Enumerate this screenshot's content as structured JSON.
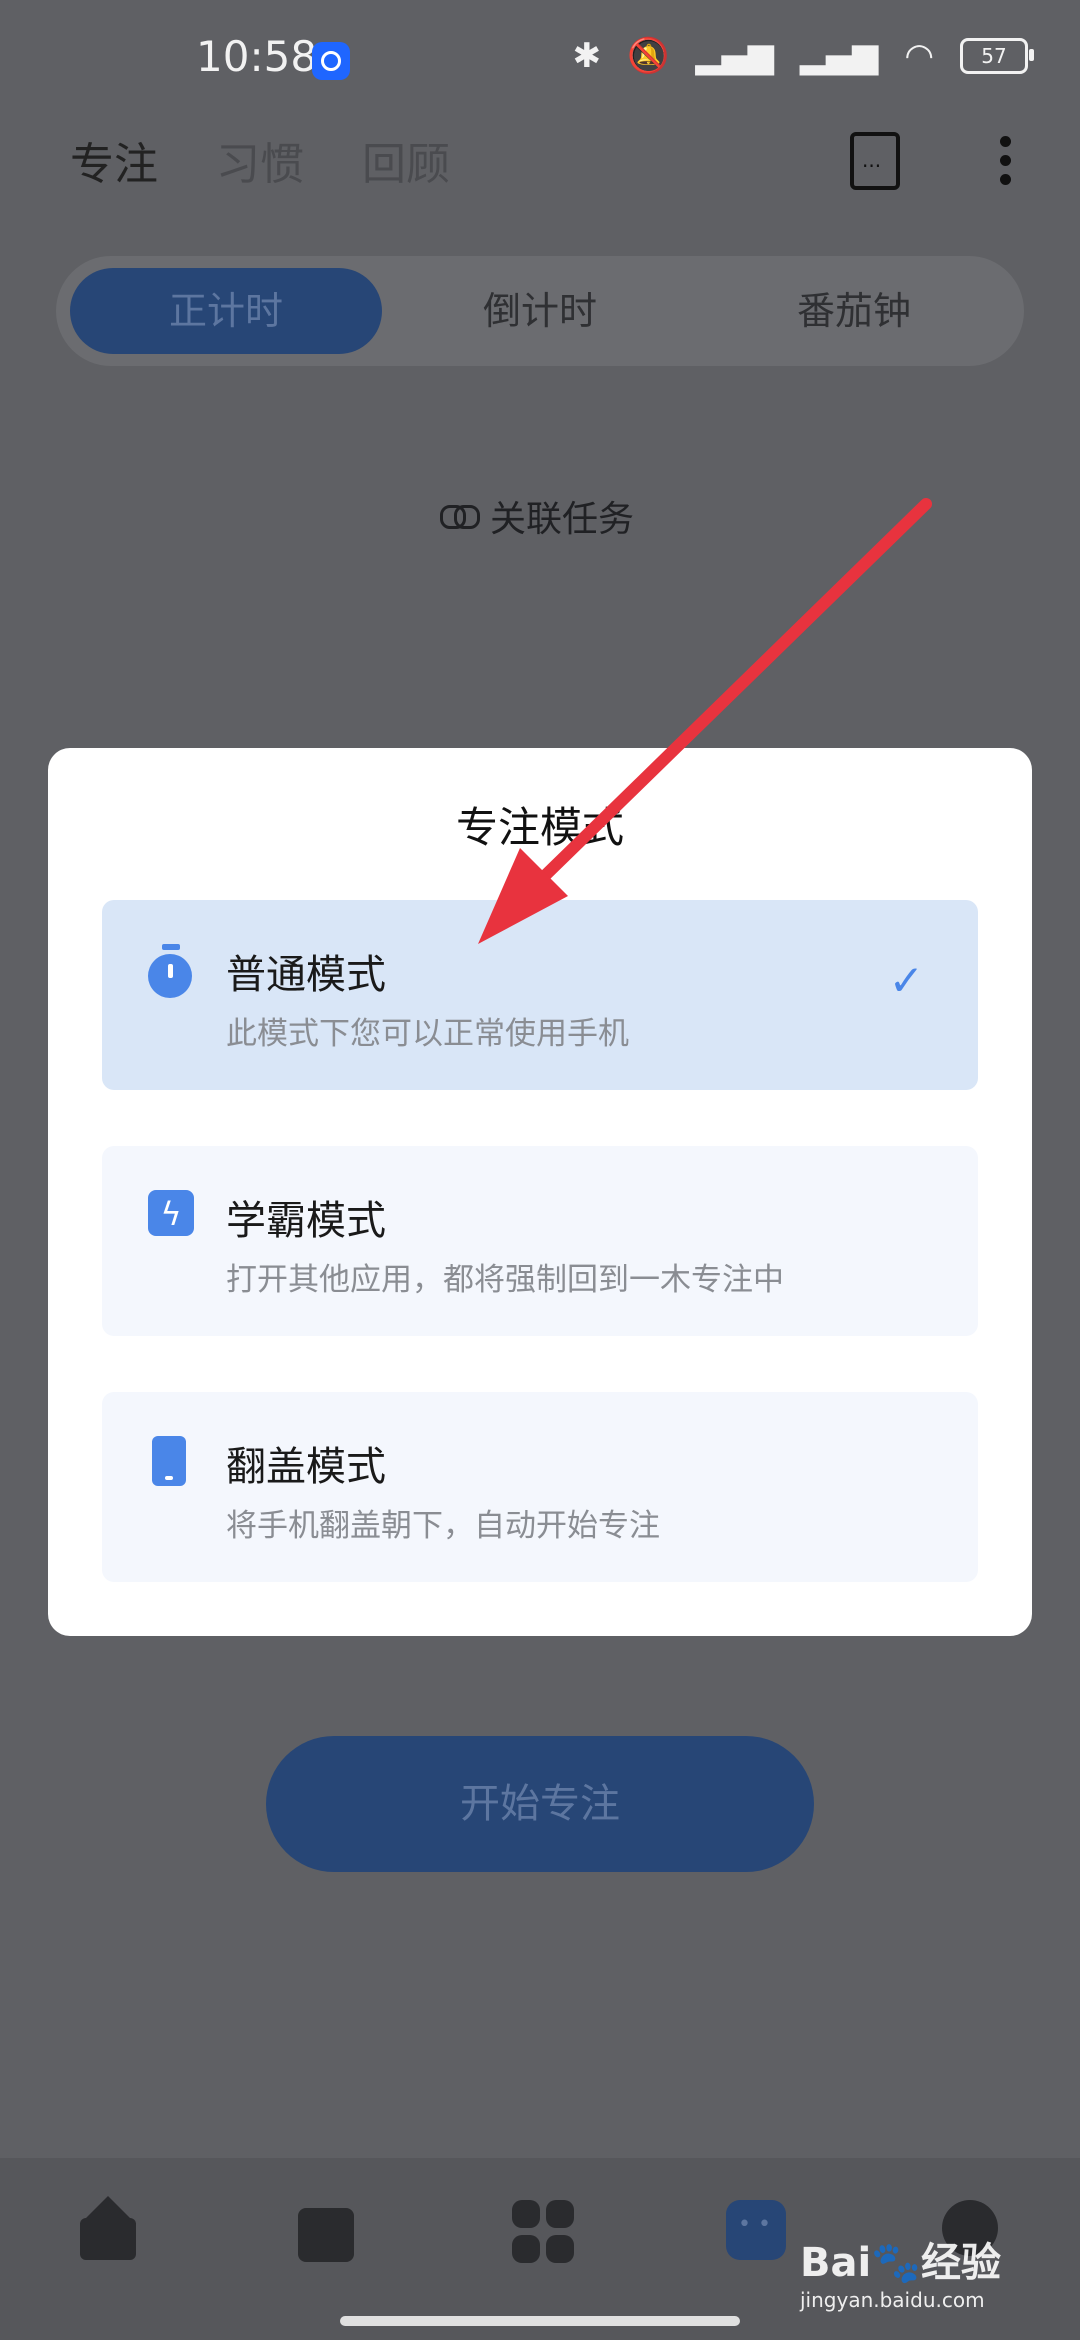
{
  "status_bar": {
    "time": "10:58",
    "battery": "57",
    "icons": [
      "bluetooth-icon",
      "mute-icon",
      "signal-hd-icon",
      "signal-hd-icon",
      "wifi-icon"
    ]
  },
  "header": {
    "tabs": [
      {
        "label": "专注",
        "active": true
      },
      {
        "label": "习惯",
        "active": false
      },
      {
        "label": "回顾",
        "active": false
      }
    ],
    "doc_icon_glyph": "..."
  },
  "segment": {
    "items": [
      {
        "label": "正计时",
        "active": true
      },
      {
        "label": "倒计时",
        "active": false
      },
      {
        "label": "番茄钟",
        "active": false
      }
    ]
  },
  "link_task": {
    "label": "关联任务"
  },
  "start_button": {
    "label": "开始专注"
  },
  "dialog": {
    "title": "专注模式",
    "options": [
      {
        "title": "普通模式",
        "desc": "此模式下您可以正常使用手机",
        "icon": "timer-icon",
        "selected": true
      },
      {
        "title": "学霸模式",
        "desc": "打开其他应用，都将强制回到一木专注中",
        "icon": "lightning-icon",
        "selected": false
      },
      {
        "title": "翻盖模式",
        "desc": "将手机翻盖朝下，自动开始专注",
        "icon": "phone-icon",
        "selected": false
      }
    ],
    "check_glyph": "✓"
  },
  "bottom_nav": {
    "items": [
      "home-icon",
      "calendar-icon",
      "apps-icon",
      "focus-icon",
      "profile-icon"
    ]
  },
  "watermark": {
    "text": "Bai🐾经验",
    "url": "jingyan.baidu.com"
  },
  "colors": {
    "accent": "#4a86e8",
    "dim_overlay": "#5f6064",
    "annotation_arrow": "#e8333e"
  }
}
